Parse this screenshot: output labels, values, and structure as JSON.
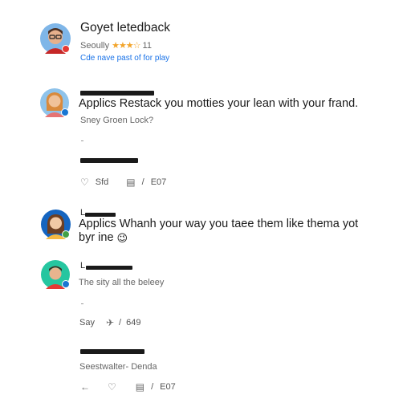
{
  "header": {
    "title": "Goyet letedback",
    "rating_label": "Seoully",
    "stars": "★★★☆",
    "rating_count": "11",
    "link": "Cde nave past of for play"
  },
  "comments": [
    {
      "text": "Applics Restack you motties your lean with your frand.",
      "sub": "Sney Groen Lock?",
      "likes": "Sfd",
      "replies": "E07"
    },
    {
      "name": "L",
      "text_line1": "Applics Whanh your way you taee them like thema yot",
      "text_line2": "byr ine",
      "emoji": "😉"
    },
    {
      "name": "L",
      "sub": "The sity all the beleey",
      "say": "Say",
      "count": "649"
    },
    {
      "sub": "Seestwalter- Denda",
      "count": "E07"
    }
  ],
  "colors": {
    "star": "#f2a42a",
    "link": "#1a73e8",
    "badge_red": "#e53935",
    "badge_blue": "#1976d2",
    "badge_green": "#43a047"
  }
}
